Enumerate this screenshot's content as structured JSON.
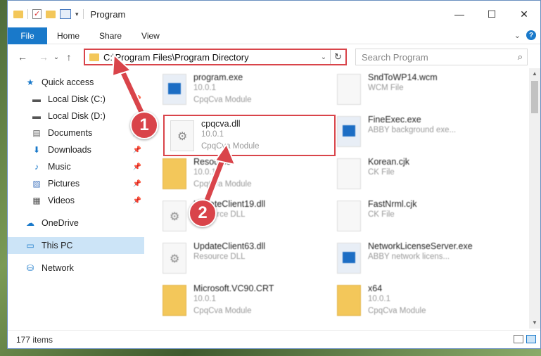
{
  "window": {
    "title": "Program",
    "controls": {
      "minimize": "—",
      "maximize": "☐",
      "close": "✕"
    }
  },
  "ribbon": {
    "file": "File",
    "tabs": [
      "Home",
      "Share",
      "View"
    ],
    "help": "?"
  },
  "nav": {
    "back": "←",
    "forward": "→",
    "dropdown": "⌄",
    "up": "↑",
    "address": "C:\\Program Files\\Program Directory",
    "refresh": "↻",
    "search_placeholder": "Search Program",
    "search_icon": "⌕"
  },
  "sidebar": {
    "items": [
      {
        "label": "Quick access",
        "icon": "star-icon",
        "glyph": "★",
        "color": "#1979ca"
      },
      {
        "label": "Local Disk (C:)",
        "icon": "drive-icon",
        "glyph": "▬",
        "color": "#555"
      },
      {
        "label": "Local Disk (D:)",
        "icon": "drive-icon",
        "glyph": "▬",
        "color": "#555"
      },
      {
        "label": "Documents",
        "icon": "documents-icon",
        "glyph": "▤",
        "color": "#666"
      },
      {
        "label": "Downloads",
        "icon": "downloads-icon",
        "glyph": "⬇",
        "color": "#1979ca"
      },
      {
        "label": "Music",
        "icon": "music-icon",
        "glyph": "♪",
        "color": "#1979ca"
      },
      {
        "label": "Pictures",
        "icon": "pictures-icon",
        "glyph": "▨",
        "color": "#4a7bc0"
      },
      {
        "label": "Videos",
        "icon": "videos-icon",
        "glyph": "▦",
        "color": "#555"
      },
      {
        "label": "OneDrive",
        "icon": "onedrive-icon",
        "glyph": "☁",
        "color": "#1979ca"
      },
      {
        "label": "This PC",
        "icon": "pc-icon",
        "glyph": "▭",
        "color": "#1979ca"
      },
      {
        "label": "Network",
        "icon": "network-icon",
        "glyph": "⛁",
        "color": "#1979ca"
      }
    ]
  },
  "files": [
    {
      "name": "program.exe",
      "line2": "10.0.1",
      "line3": "CpqCva Module"
    },
    {
      "name": "SndToWP14.wcm",
      "line2": "WCM File",
      "line3": ""
    },
    {
      "name": "cpqcva.dll",
      "line2": "10.0.1",
      "line3": "CpqCva Module"
    },
    {
      "name": "FineExec.exe",
      "line2": "ABBY background exe...",
      "line3": ""
    },
    {
      "name": "Resource",
      "line2": "10.0.1",
      "line3": "CpqCva Module"
    },
    {
      "name": "Korean.cjk",
      "line2": "CK File",
      "line3": ""
    },
    {
      "name": "UpdateClient19.dll",
      "line2": "Resource DLL",
      "line3": ""
    },
    {
      "name": "FastNrml.cjk",
      "line2": "CK File",
      "line3": ""
    },
    {
      "name": "UpdateClient63.dll",
      "line2": "Resource DLL",
      "line3": ""
    },
    {
      "name": "NetworkLicenseServer.exe",
      "line2": "ABBY network licens...",
      "line3": ""
    },
    {
      "name": "Microsoft.VC90.CRT",
      "line2": "10.0.1",
      "line3": "CpqCva Module"
    },
    {
      "name": "x64",
      "line2": "10.0.1",
      "line3": "CpqCva Module"
    }
  ],
  "status": {
    "count": "177 items"
  },
  "annotations": {
    "step1": "1",
    "step2": "2"
  }
}
